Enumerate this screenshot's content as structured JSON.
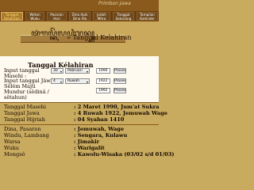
{
  "banner": {
    "title": "Primbon Jawa"
  },
  "nav": {
    "tabs": [
      {
        "label_line1": "Tanggal",
        "label_line2": "Kelahiran",
        "active": true
      },
      {
        "label_line1": "Weton",
        "label_line2": "Wuku",
        "active": false
      },
      {
        "label_line1": "Pasaran",
        "label_line2": "Hari",
        "active": false
      },
      {
        "label_line1": "Dina Apik",
        "label_line2": "Dina Ala",
        "active": false
      },
      {
        "label_line1": "Jodoh",
        "label_line2": "Mitra",
        "active": false
      },
      {
        "label_line1": "Tanggal",
        "label_line2": "Sekarang",
        "active": false
      },
      {
        "label_line1": "Tampilan",
        "label_line2": "Kalender",
        "active": false
      }
    ]
  },
  "header": {
    "javanese": "ꦠꦁꦒꦭ꧀ꦏꦼꦭꦲꦶꦫꦤ꧀",
    "separator": "»",
    "title": "Tanggal Kelahiran"
  },
  "section": {
    "title": "Tanggal Kélahiran"
  },
  "form": {
    "masehi_label_1": "Input tanggal",
    "masehi_label_2": "Masehi :",
    "masehi_day": "30",
    "masehi_month": "Pebruari",
    "masehi_year": "1990",
    "masehi_button": "Proses",
    "jawa_label_1": "Input tanggal Jâwâ",
    "jawa_label_2": "Sêlêm Majti",
    "jawa_label_3": "Mundur (sêdinâ /",
    "jawa_label_4": "sêtahun)",
    "jawa_day": "4",
    "jawa_month": "Ruwah",
    "jawa_year": "1922",
    "jawa_button": "Proses",
    "extra_year": "1992",
    "extra_button": "Proses"
  },
  "results": {
    "masehi": {
      "label": "Tanggal Masehi",
      "value": ": 2 Maret 1990, Jum'at Sukra"
    },
    "jawa": {
      "label": "Tanggal Jawa",
      "value": ": 4 Ruwah 1922, Jemuwah Wage"
    },
    "hijriah": {
      "label": "Tanggal Hijriah",
      "value": ": 04 Syaban 1410"
    },
    "dina_pasaran": {
      "label": "Dina, Pasaran",
      "value": ": Jemuwah, Wage"
    },
    "windu_lambang": {
      "label": "Windu, Lambang",
      "value": ": Sengara, Kulawu"
    },
    "warsa": {
      "label": "Warsa",
      "value": ": Jimakir"
    },
    "wuku": {
      "label": "Wuku",
      "value": ": Warigalit"
    },
    "mongso": {
      "label": "Mongsô",
      "value": ": Kawolu-Wisaka (03/02 s/d 01/03)"
    }
  }
}
